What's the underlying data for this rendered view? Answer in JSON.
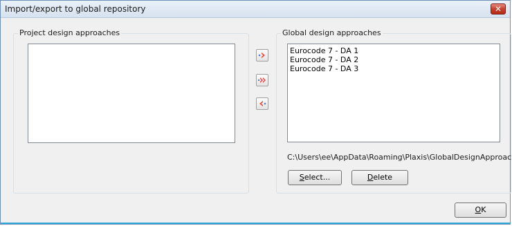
{
  "window": {
    "title": "Import/export to global repository",
    "close_glyph": "✕"
  },
  "project_group": {
    "label": "Project design approaches",
    "items": []
  },
  "global_group": {
    "label": "Global design approaches",
    "items": [
      "Eurocode 7 - DA 1",
      "Eurocode 7 - DA 2",
      "Eurocode 7 - DA 3"
    ],
    "path": "C:\\Users\\ee\\AppData\\Roaming\\Plaxis\\GlobalDesignApproaches.",
    "select_mnemonic": "S",
    "select_rest": "elect...",
    "delete_mnemonic": "D",
    "delete_rest": "elete"
  },
  "transfer_buttons": {
    "icons": [
      "arrow-right-icon",
      "double-arrow-right-icon",
      "arrow-left-icon"
    ],
    "arrow_color": "#e8443a",
    "dot_color": "#4a7fc8"
  },
  "footer": {
    "ok_mnemonic": "O",
    "ok_rest": "K"
  }
}
